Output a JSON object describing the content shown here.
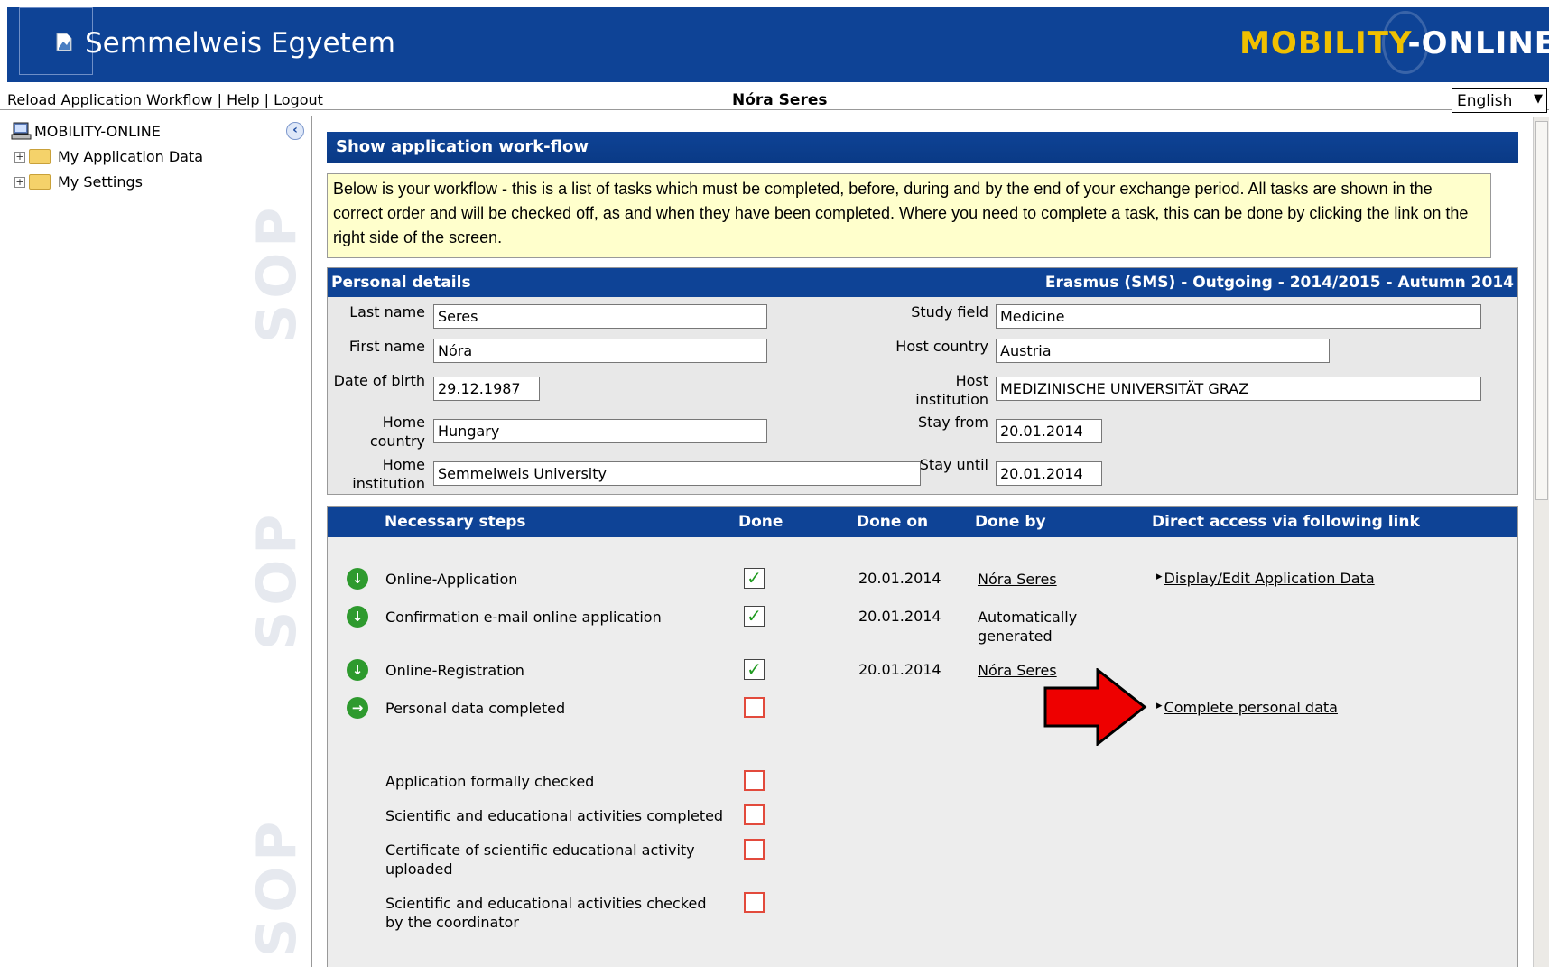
{
  "header": {
    "app_title": "Semmelweis Egyetem",
    "brand_part1": "MOBILITY",
    "brand_part2": "-ONLINE"
  },
  "topbar": {
    "reload_label": "Reload Application Workflow",
    "help_label": "Help",
    "logout_label": "Logout",
    "user_name": "Nóra Seres",
    "language": "English"
  },
  "sidebar": {
    "root_label": "MOBILITY-ONLINE",
    "items": [
      {
        "label": "My Application Data"
      },
      {
        "label": "My Settings"
      }
    ],
    "watermark": "SOP"
  },
  "main": {
    "section_title": "Show application work-flow",
    "intro_text": "Below is your workflow - this is a list of tasks which must be completed, before, during and by the end of your exchange period.  All tasks are shown in the correct order and will be checked off, as and when they have been completed.  Where you need to complete a task, this can be done by clicking the link on the right side of the screen."
  },
  "personal": {
    "title": "Personal details",
    "program": "Erasmus (SMS) - Outgoing - 2014/2015 - Autumn 2014",
    "last_name_label": "Last name",
    "last_name": "Seres",
    "first_name_label": "First name",
    "first_name": "Nóra",
    "dob_label": "Date of birth",
    "dob": "29.12.1987",
    "home_country_label": "Home country",
    "home_country": "Hungary",
    "home_institution_label": "Home institution",
    "home_institution": "Semmelweis University",
    "study_field_label": "Study field",
    "study_field": "Medicine",
    "host_country_label": "Host country",
    "host_country": "Austria",
    "host_institution_label": "Host institution",
    "host_institution": "MEDIZINISCHE UNIVERSITÄT GRAZ",
    "stay_from_label": "Stay from",
    "stay_from": "20.01.2014",
    "stay_until_label": "Stay until",
    "stay_until": "20.01.2014"
  },
  "steps": {
    "col_steps": "Necessary steps",
    "col_done": "Done",
    "col_done_on": "Done on",
    "col_done_by": "Done by",
    "col_link": "Direct access via following link",
    "rows": [
      {
        "name": "Online-Application",
        "done": true,
        "date": "20.01.2014",
        "by": "Nóra Seres",
        "link": "Display/Edit Application Data",
        "icon": "down-arrow-icon"
      },
      {
        "name": "Confirmation e-mail online application",
        "done": true,
        "date": "20.01.2014",
        "by": "Automatically generated",
        "link": "",
        "icon": "down-arrow-icon"
      },
      {
        "name": "Online-Registration",
        "done": true,
        "date": "20.01.2014",
        "by": "Nóra Seres",
        "link": "",
        "icon": "down-arrow-icon"
      },
      {
        "name": "Personal data completed",
        "done": false,
        "date": "",
        "by": "",
        "link": "Complete personal data",
        "icon": "right-arrow-icon"
      },
      {
        "name": "Application formally checked",
        "done": false,
        "date": "",
        "by": "",
        "link": "",
        "icon": ""
      },
      {
        "name": "Scientific and educational activities completed",
        "done": false,
        "date": "",
        "by": "",
        "link": "",
        "icon": ""
      },
      {
        "name": "Certificate of scientific educational activity uploaded",
        "done": false,
        "date": "",
        "by": "",
        "link": "",
        "icon": ""
      },
      {
        "name": "Scientific and educational activities checked by the coordinator",
        "done": false,
        "date": "",
        "by": "",
        "link": "",
        "icon": ""
      }
    ]
  },
  "colors": {
    "header_blue": "#0e4396",
    "brand_yellow": "#f0c000",
    "intro_bg": "#ffffcc",
    "check_green": "#1e9a1e",
    "unchecked_red": "#e24a3c",
    "annotation_red": "#ee0000"
  }
}
